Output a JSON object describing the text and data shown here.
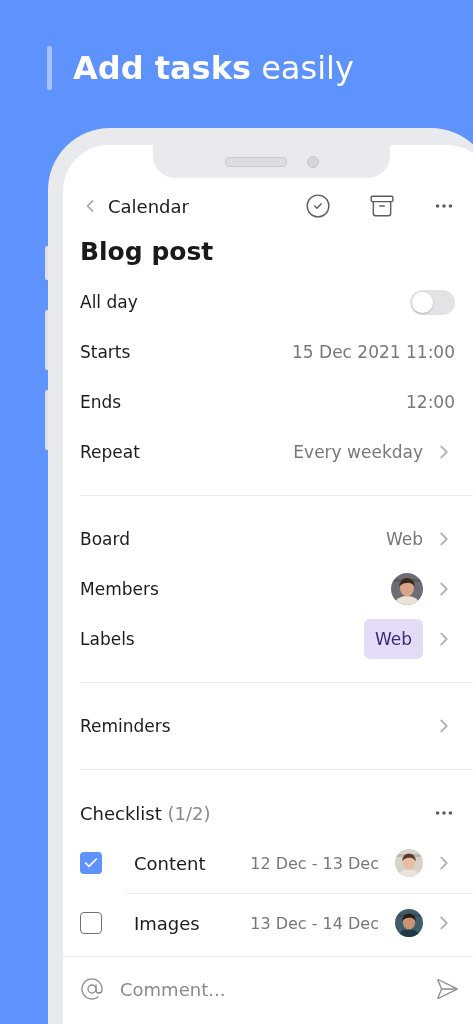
{
  "headline": "**Add tasks** easily",
  "nav": {
    "back_label": "Calendar"
  },
  "title": "Blog post",
  "schedule": [
    {
      "kind": "toggle",
      "label": "All day",
      "on": false
    },
    {
      "kind": "value",
      "label": "Starts",
      "value": "15 Dec 2021 11:00"
    },
    {
      "kind": "value",
      "label": "Ends",
      "value": "12:00"
    },
    {
      "kind": "link",
      "label": "Repeat",
      "value": "Every weekday"
    }
  ],
  "details": [
    {
      "kind": "link",
      "label": "Board",
      "value": "Web"
    },
    {
      "kind": "avatar",
      "label": "Members"
    },
    {
      "kind": "tag",
      "label": "Labels",
      "value": "Web"
    }
  ],
  "reminders": {
    "label": "Reminders"
  },
  "checklist": {
    "title": "Checklist",
    "count": "(1/2)",
    "items": [
      {
        "label": "Content",
        "dates": "12 Dec - 13 Dec",
        "checked": true
      },
      {
        "label": "Images",
        "dates": "13 Dec - 14 Dec",
        "checked": false
      }
    ]
  },
  "comment": {
    "placeholder": "Comment..."
  }
}
